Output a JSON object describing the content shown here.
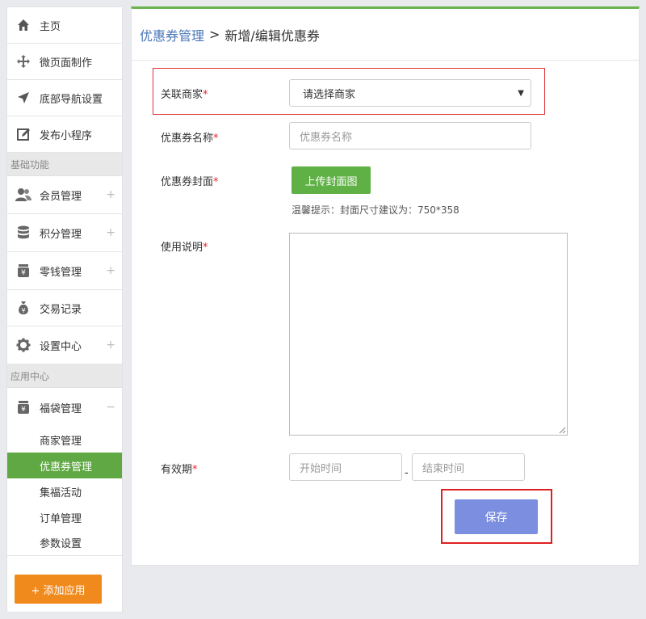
{
  "sidebar": {
    "top_items": [
      {
        "label": "主页",
        "icon": "home-icon"
      },
      {
        "label": "微页面制作",
        "icon": "move-icon"
      },
      {
        "label": "底部导航设置",
        "icon": "navigation-arrow-icon"
      },
      {
        "label": "发布小程序",
        "icon": "edit-icon"
      }
    ],
    "section_basic": "基础功能",
    "basic_items": [
      {
        "label": "会员管理",
        "icon": "users-icon",
        "expand": "+"
      },
      {
        "label": "积分管理",
        "icon": "database-icon",
        "expand": "+"
      },
      {
        "label": "零钱管理",
        "icon": "yuan-jar-icon",
        "expand": "+"
      },
      {
        "label": "交易记录",
        "icon": "money-bag-icon"
      },
      {
        "label": "设置中心",
        "icon": "gear-icon",
        "expand": "+"
      }
    ],
    "section_app": "应用中心",
    "app_items": [
      {
        "label": "福袋管理",
        "icon": "yuan-jar-icon",
        "expand": "−"
      }
    ],
    "sub_items": [
      "商家管理",
      "优惠券管理",
      "集福活动",
      "订单管理",
      "参数设置"
    ],
    "active_sub": "优惠券管理",
    "add_app_label": "+ 添加应用"
  },
  "breadcrumb": {
    "parent": "优惠券管理",
    "separator": ">",
    "current": "新增/编辑优惠券"
  },
  "form": {
    "merchant_label": "关联商家",
    "merchant_select_value": "请选择商家",
    "name_label": "优惠券名称",
    "name_placeholder": "优惠券名称",
    "cover_label": "优惠券封面",
    "upload_label": "上传封面图",
    "cover_hint": "温馨提示：封面尺寸建议为：750*358",
    "usage_label": "使用说明",
    "validity_label": "有效期",
    "start_placeholder": "开始时间",
    "range_separator": "-",
    "end_placeholder": "结束时间",
    "required_mark": "*",
    "save_label": "保存"
  },
  "colors": {
    "accent_green": "#5fa844",
    "link_blue": "#4a76b8",
    "orange_button": "#f08a1c",
    "save_button": "#7b8ee0",
    "highlight_red": "#e02020"
  }
}
